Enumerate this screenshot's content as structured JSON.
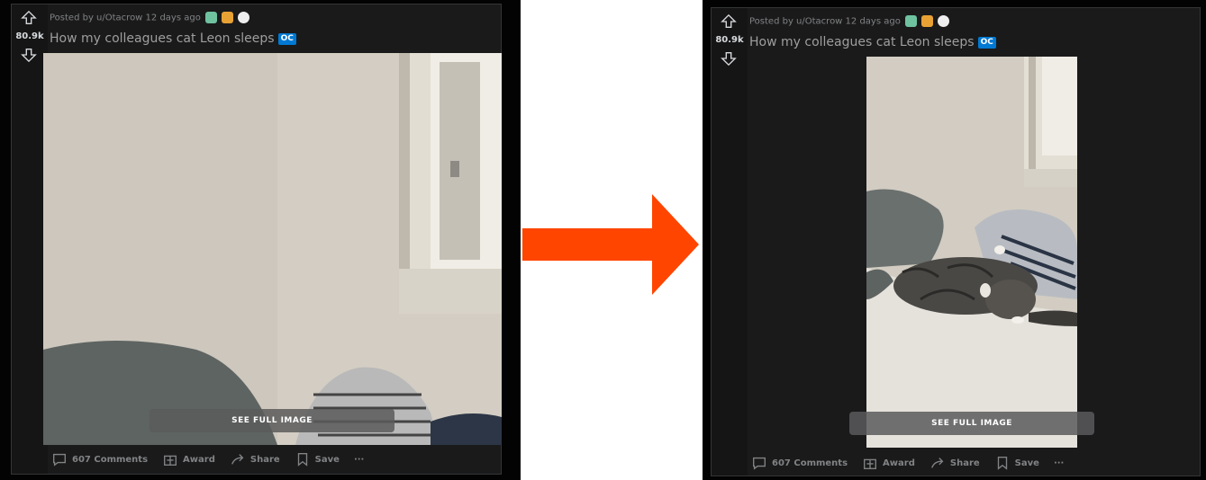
{
  "colors": {
    "arrow": "#ff4500",
    "oc_badge": "#0079d3",
    "card_bg": "#1a1a1b",
    "panel_bg": "#030303"
  },
  "before": {
    "score": "80.9k",
    "meta": "Posted by u/Otacrow 12 days ago",
    "title": "How my colleagues cat Leon sleeps",
    "flair": "OC",
    "see_full": "SEE FULL IMAGE",
    "actions": {
      "comments": "607 Comments",
      "award": "Award",
      "share": "Share",
      "save": "Save",
      "more": "···"
    }
  },
  "after": {
    "score": "80.9k",
    "meta": "Posted by u/Otacrow 12 days ago",
    "title": "How my colleagues cat Leon sleeps",
    "flair": "OC",
    "see_full": "SEE FULL IMAGE",
    "actions": {
      "comments": "607 Comments",
      "award": "Award",
      "share": "Share",
      "save": "Save",
      "more": "···"
    }
  }
}
